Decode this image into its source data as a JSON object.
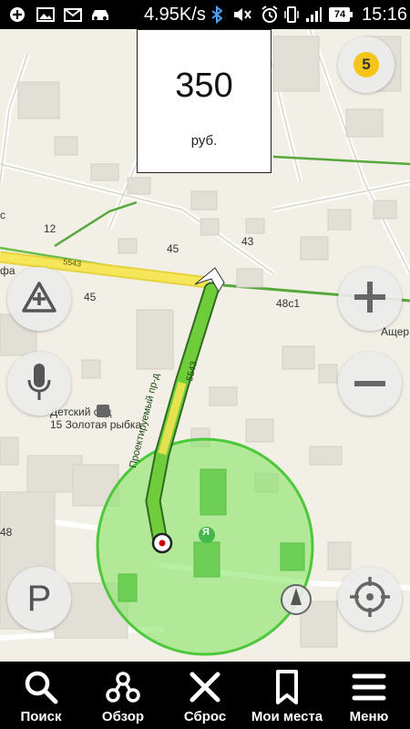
{
  "status_bar": {
    "network_speed": "4.95K/s",
    "battery": "74",
    "time": "15:16",
    "icons": [
      "add-circle-icon",
      "image-icon",
      "mail-icon",
      "car-icon",
      "bluetooth-icon",
      "mute-icon",
      "alarm-icon",
      "vibrate-icon",
      "signal-icon",
      "battery-icon"
    ]
  },
  "fare": {
    "amount": "350",
    "currency": "руб."
  },
  "map": {
    "road_name": "Проектируемый пр-д",
    "road_number": "5543",
    "road_number_2": "5543",
    "labels": {
      "building_12": "12",
      "building_45a": "45",
      "building_43": "43",
      "building_45b": "45",
      "building_48c1": "48с1",
      "building_48": "48",
      "street_acher": "Ащер",
      "street_fa": "фа",
      "street_s": "с",
      "poi_kindergarten_1": "Детский сад",
      "poi_kindergarten_2": "15 Золотая рыбка",
      "yandex_marker": "Я"
    },
    "colors": {
      "route_green": "#4caf3a",
      "route_yellow": "#f6e65a",
      "accuracy_circle": "#7be35a",
      "background": "#f1efe6"
    }
  },
  "controls": {
    "traffic_level": "5",
    "icons": [
      "traffic-level-icon",
      "add-road-event-icon",
      "voice-search-icon",
      "parking-icon",
      "zoom-in-icon",
      "zoom-out-icon",
      "compass-icon",
      "my-location-icon"
    ]
  },
  "bottom_nav": {
    "items": [
      {
        "label": "Поиск",
        "icon": "search-icon"
      },
      {
        "label": "Обзор",
        "icon": "overview-route-icon"
      },
      {
        "label": "Сброс",
        "icon": "close-icon"
      },
      {
        "label": "Мои места",
        "icon": "bookmark-icon"
      },
      {
        "label": "Меню",
        "icon": "menu-icon"
      }
    ]
  }
}
